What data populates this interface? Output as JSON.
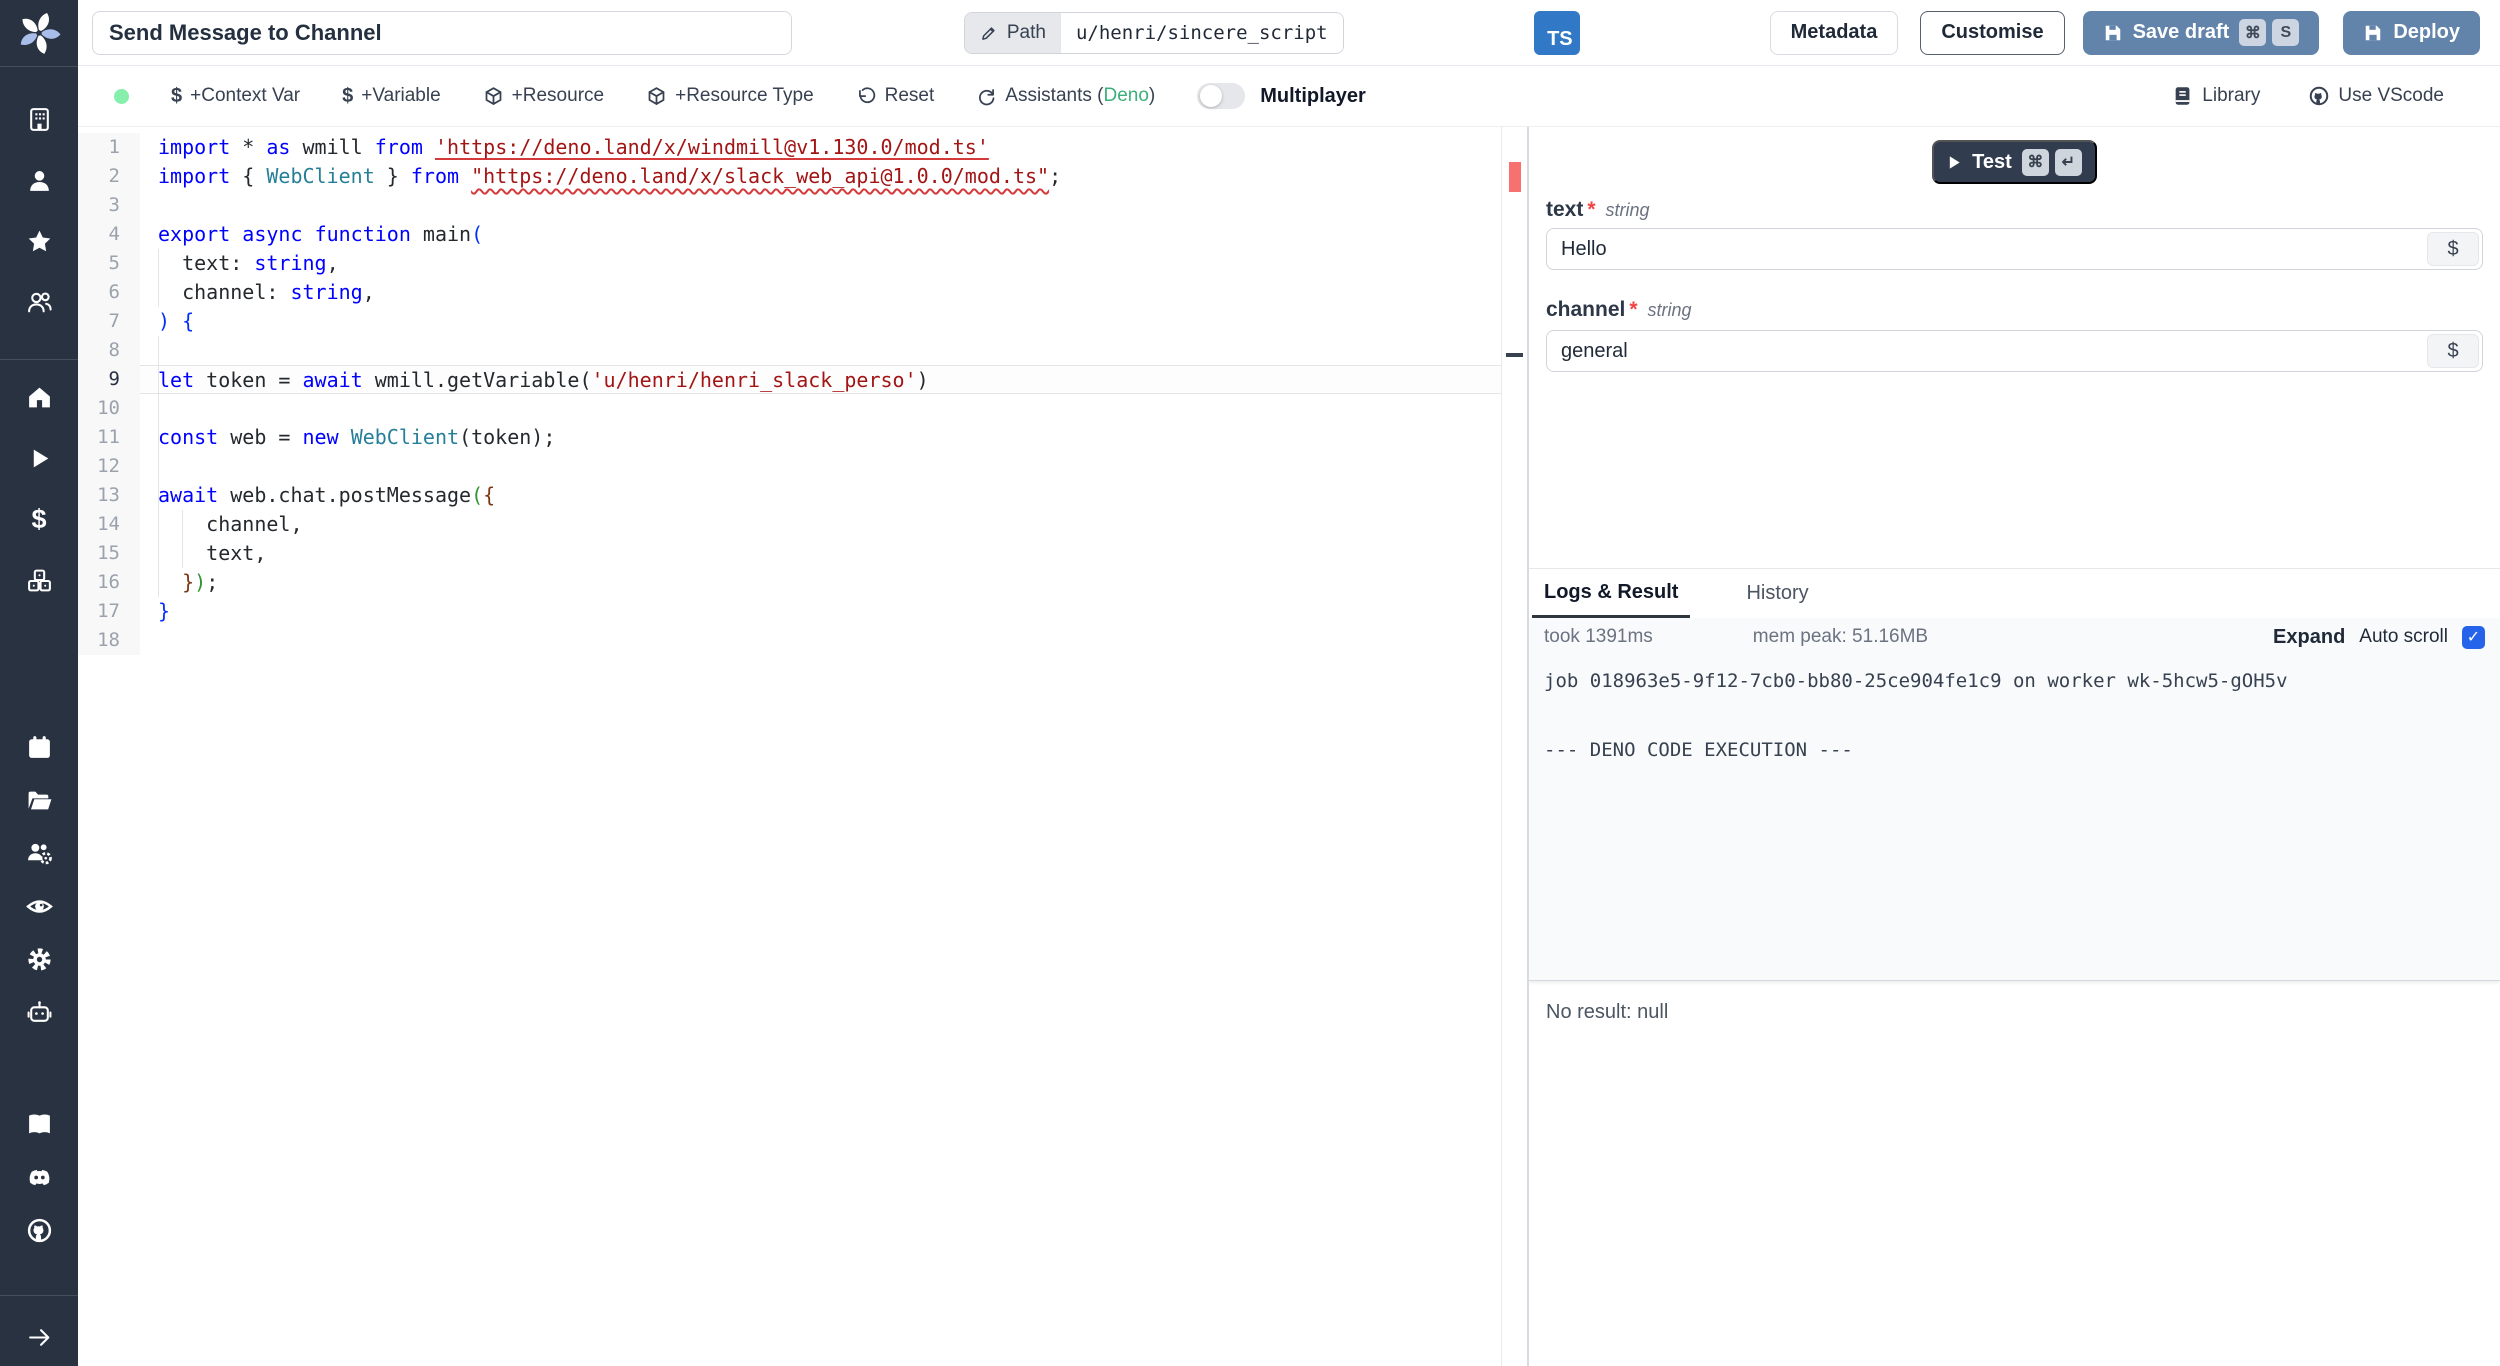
{
  "topbar": {
    "title_value": "Send Message to Channel",
    "path_label": "Path",
    "path_value": "u/henri/sincere_script",
    "lang_badge": "TS",
    "metadata_label": "Metadata",
    "customise_label": "Customise",
    "save_draft_label": "Save draft",
    "save_draft_keys": [
      "⌘",
      "S"
    ],
    "deploy_label": "Deploy"
  },
  "toolbar": {
    "dollar": "$",
    "context_var": "+Context Var",
    "variable": "+Variable",
    "resource": "+Resource",
    "resource_type": "+Resource Type",
    "reset": "Reset",
    "assistants_prefix": "Assistants (",
    "assistants_lang": "Deno",
    "assistants_suffix": ")",
    "multiplayer": "Multiplayer",
    "library": "Library",
    "use_vscode": "Use VScode"
  },
  "sidebar": {
    "icons": [
      "windmill-logo",
      "building-icon",
      "person-icon",
      "star-icon",
      "users-icon",
      "home-icon",
      "play-icon",
      "dollar-icon",
      "cubes-icon",
      "calendar-icon",
      "folder-icon",
      "users-gear-icon",
      "eye-icon",
      "gear-icon",
      "robot-icon",
      "book-icon",
      "discord-icon",
      "github-icon",
      "arrow-right-icon"
    ]
  },
  "editor": {
    "lines": [
      {
        "n": 1,
        "s": [
          [
            "kw",
            "import"
          ],
          [
            "pl",
            " * "
          ],
          [
            "kw",
            "as"
          ],
          [
            "pl",
            " wmill "
          ],
          [
            "kw",
            "from"
          ],
          [
            "pl",
            " "
          ],
          [
            "strs",
            "'https://deno.land/x/windmill@v1.130.0/mod.ts'"
          ]
        ]
      },
      {
        "n": 2,
        "s": [
          [
            "kw",
            "import"
          ],
          [
            "pl",
            " { "
          ],
          [
            "typ",
            "WebClient"
          ],
          [
            "pl",
            " } "
          ],
          [
            "kw",
            "from"
          ],
          [
            "pl",
            " "
          ],
          [
            "strw",
            "\"https://deno.land/x/slack_web_api@1.0.0/mod.ts\""
          ],
          [
            "pl",
            ";"
          ]
        ]
      },
      {
        "n": 3,
        "s": []
      },
      {
        "n": 4,
        "s": [
          [
            "kw",
            "export"
          ],
          [
            "pl",
            " "
          ],
          [
            "kw",
            "async"
          ],
          [
            "pl",
            " "
          ],
          [
            "kw",
            "function"
          ],
          [
            "pl",
            " main"
          ],
          [
            "brb",
            "("
          ]
        ]
      },
      {
        "n": 5,
        "g": [
          0
        ],
        "s": [
          [
            "pl",
            "  text: "
          ],
          [
            "kw",
            "string"
          ],
          [
            "pl",
            ","
          ]
        ]
      },
      {
        "n": 6,
        "g": [
          0
        ],
        "s": [
          [
            "pl",
            "  channel: "
          ],
          [
            "kw",
            "string"
          ],
          [
            "pl",
            ","
          ]
        ]
      },
      {
        "n": 7,
        "s": [
          [
            "brb",
            ")"
          ],
          [
            "pl",
            " "
          ],
          [
            "brb",
            "{"
          ]
        ]
      },
      {
        "n": 8,
        "g": [
          0
        ],
        "s": []
      },
      {
        "n": 9,
        "cur": true,
        "g": [
          0
        ],
        "s": [
          [
            "kw",
            "let"
          ],
          [
            "pl",
            " token = "
          ],
          [
            "kw",
            "await"
          ],
          [
            "pl",
            " wmill.getVariable("
          ],
          [
            "str",
            "'u/henri/henri_slack_perso'"
          ],
          [
            "pl",
            ")"
          ]
        ]
      },
      {
        "n": 10,
        "g": [
          0
        ],
        "s": []
      },
      {
        "n": 11,
        "g": [
          0
        ],
        "s": [
          [
            "kw",
            "const"
          ],
          [
            "pl",
            " web = "
          ],
          [
            "kw",
            "new"
          ],
          [
            "pl",
            " "
          ],
          [
            "typ",
            "WebClient"
          ],
          [
            "pl",
            "(token);"
          ]
        ]
      },
      {
        "n": 12,
        "g": [
          0
        ],
        "s": []
      },
      {
        "n": 13,
        "g": [
          0
        ],
        "s": [
          [
            "kw",
            "await"
          ],
          [
            "pl",
            " web.chat.postMessage"
          ],
          [
            "brg",
            "("
          ],
          [
            "bro",
            "{"
          ]
        ]
      },
      {
        "n": 14,
        "g": [
          0,
          1
        ],
        "s": [
          [
            "pl",
            "    channel,"
          ]
        ]
      },
      {
        "n": 15,
        "g": [
          0,
          1
        ],
        "s": [
          [
            "pl",
            "    text,"
          ]
        ]
      },
      {
        "n": 16,
        "g": [
          0
        ],
        "s": [
          [
            "pl",
            "  "
          ],
          [
            "bro",
            "}"
          ],
          [
            "brg",
            ")"
          ],
          [
            "pl",
            ";"
          ]
        ]
      },
      {
        "n": 17,
        "s": [
          [
            "brb",
            "}"
          ]
        ]
      },
      {
        "n": 18,
        "s": []
      }
    ]
  },
  "panel": {
    "test_label": "Test",
    "test_keys": [
      "⌘",
      "↵"
    ],
    "required_mark": "*",
    "fields": [
      {
        "name": "text",
        "type": "string",
        "value": "Hello",
        "suffix": "$"
      },
      {
        "name": "channel",
        "type": "string",
        "value": "general",
        "suffix": "$"
      }
    ],
    "tabs": [
      "Logs & Result",
      "History"
    ],
    "meta": {
      "took": "took 1391ms",
      "mem": "mem peak: 51.16MB",
      "expand": "Expand",
      "autoscroll": "Auto scroll",
      "check": "✓"
    },
    "logs": [
      "job 018963e5-9f12-7cb0-bb80-25ce904fe1c9 on worker wk-5hcw5-gOH5v",
      "--- DENO CODE EXECUTION ---"
    ],
    "result": "No result: null"
  },
  "colors": {
    "primary_button": "#6283aa",
    "ts_badge": "#3178c6",
    "assistants_green": "#3cb07a",
    "status_dot": "#86efac",
    "checkbox_blue": "#2563eb",
    "error_mark": "#f87171",
    "sidebar_bg": "#293241"
  }
}
